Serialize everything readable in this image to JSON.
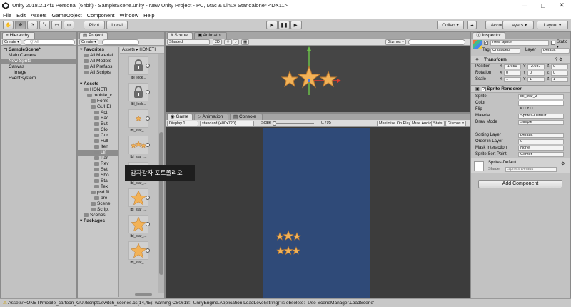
{
  "window": {
    "title": "Unity 2018.2.14f1 Personal (64bit) - SampleScene.unity - New Unity Project - PC, Mac & Linux Standalone* <DX11>",
    "controls": [
      "─",
      "□",
      "✕"
    ]
  },
  "menu": [
    "File",
    "Edit",
    "Assets",
    "GameObject",
    "Component",
    "Window",
    "Help"
  ],
  "toolbar": {
    "pivot": "Pivot",
    "local": "Local",
    "collab": "Collab ▾",
    "account": "Account ▾",
    "layers": "Layers ▾",
    "layout": "Layout ▾"
  },
  "hierarchy": {
    "tab": "Hierarchy",
    "create": "Create ▾",
    "search_placeholder": "Q*All",
    "rows": [
      {
        "label": "SampleScene*",
        "indent": 0,
        "kind": "scene",
        "selected": false
      },
      {
        "label": "Main Camera",
        "indent": 1,
        "kind": "obj",
        "selected": false
      },
      {
        "label": "New Sprite",
        "indent": 1,
        "kind": "obj",
        "selected": true
      },
      {
        "label": "Canvas",
        "indent": 1,
        "kind": "obj",
        "selected": false
      },
      {
        "label": "Image",
        "indent": 2,
        "kind": "obj",
        "selected": false
      },
      {
        "label": "EventSystem",
        "indent": 1,
        "kind": "obj",
        "selected": false
      }
    ]
  },
  "project": {
    "tab": "Project",
    "create": "Create ▾",
    "breadcrumb": "Assets ▸ HONETI",
    "tree": [
      {
        "label": "Favorites",
        "indent": 0,
        "bold": true,
        "selected": false
      },
      {
        "label": "All Material",
        "indent": 1,
        "bold": false,
        "selected": false
      },
      {
        "label": "All Models",
        "indent": 1,
        "bold": false,
        "selected": false
      },
      {
        "label": "All Prefabs",
        "indent": 1,
        "bold": false,
        "selected": false
      },
      {
        "label": "All Scripts",
        "indent": 1,
        "bold": false,
        "selected": false
      },
      {
        "label": "",
        "indent": 0,
        "bold": false,
        "selected": false
      },
      {
        "label": "Assets",
        "indent": 0,
        "bold": true,
        "selected": false
      },
      {
        "label": "HONETI",
        "indent": 1,
        "bold": false,
        "selected": false
      },
      {
        "label": "mobile_c",
        "indent": 2,
        "bold": false,
        "selected": false
      },
      {
        "label": "Fonts",
        "indent": 3,
        "bold": false,
        "selected": false
      },
      {
        "label": "GUI El",
        "indent": 3,
        "bold": false,
        "selected": false
      },
      {
        "label": "Act",
        "indent": 4,
        "bold": false,
        "selected": false
      },
      {
        "label": "Bac",
        "indent": 4,
        "bold": false,
        "selected": false
      },
      {
        "label": "But",
        "indent": 4,
        "bold": false,
        "selected": false
      },
      {
        "label": "Clo",
        "indent": 4,
        "bold": false,
        "selected": false
      },
      {
        "label": "Cur",
        "indent": 4,
        "bold": false,
        "selected": false
      },
      {
        "label": "Full",
        "indent": 4,
        "bold": false,
        "selected": false
      },
      {
        "label": "Iten",
        "indent": 4,
        "bold": false,
        "selected": false
      },
      {
        "label": "Lif",
        "indent": 4,
        "bold": false,
        "selected": true
      },
      {
        "label": "Par",
        "indent": 4,
        "bold": false,
        "selected": false
      },
      {
        "label": "Rev",
        "indent": 4,
        "bold": false,
        "selected": false
      },
      {
        "label": "Set",
        "indent": 4,
        "bold": false,
        "selected": false
      },
      {
        "label": "Sho",
        "indent": 4,
        "bold": false,
        "selected": false
      },
      {
        "label": "Sta",
        "indent": 4,
        "bold": false,
        "selected": false
      },
      {
        "label": "Tex",
        "indent": 4,
        "bold": false,
        "selected": false
      },
      {
        "label": "psd fil",
        "indent": 3,
        "bold": false,
        "selected": false
      },
      {
        "label": "pre",
        "indent": 4,
        "bold": false,
        "selected": false
      },
      {
        "label": "Scene",
        "indent": 3,
        "bold": false,
        "selected": false
      },
      {
        "label": "Script",
        "indent": 3,
        "bold": false,
        "selected": false
      },
      {
        "label": "Scenes",
        "indent": 1,
        "bold": false,
        "selected": false
      },
      {
        "label": "Packages",
        "indent": 0,
        "bold": true,
        "selected": false
      }
    ],
    "items": [
      {
        "label": "lbl_lock...",
        "kind": "lock"
      },
      {
        "label": "lbl_lock...",
        "kind": "lock"
      },
      {
        "label": "lbl_star_...",
        "kind": "star1"
      },
      {
        "label": "lbl_star_...",
        "kind": "star3"
      },
      {
        "label": "lbl_star_...",
        "kind": "star3"
      },
      {
        "label": "lbl_star_...",
        "kind": "bigstar"
      },
      {
        "label": "lbl_star_...",
        "kind": "bigstar"
      },
      {
        "label": "lbl_star_...",
        "kind": "bigstar"
      }
    ]
  },
  "scene": {
    "tab": "Scene",
    "animator_tab": "Animator",
    "shading": "Shaded",
    "mode": "2D",
    "gizmos": "Gizmos ▾"
  },
  "game": {
    "tab": "Game",
    "animation_tab": "Animation",
    "console_tab": "Console",
    "display": "Display 1",
    "resolution": "standard (400x720)",
    "scale_label": "Scale",
    "scale_value": "0.795",
    "maximize": "Maximize On Play",
    "mute": "Mute Audio",
    "stats": "Stats",
    "gizmos": "Gizmos ▾"
  },
  "inspector": {
    "tab": "Inspector",
    "name": "New Sprite",
    "static": "Static ▾",
    "tag_label": "Tag",
    "tag": "Untagged",
    "layer_label": "Layer",
    "layer": "Default",
    "transform_title": "Transform",
    "position_label": "Position",
    "position": {
      "x": "-1.659",
      "y": "-2.037",
      "z": "0"
    },
    "rotation_label": "Rotation",
    "rotation": {
      "x": "0",
      "y": "0",
      "z": "0"
    },
    "scale_label": "Scale",
    "scale": {
      "x": "1",
      "y": "1",
      "z": "1"
    },
    "renderer_title": "Sprite Renderer",
    "props": [
      {
        "label": "Sprite",
        "value": "lbl_star_3"
      },
      {
        "label": "Color",
        "value": ""
      },
      {
        "label": "Flip",
        "value": "X □  Y □"
      },
      {
        "label": "Material",
        "value": "Sprites-Default"
      },
      {
        "label": "Draw Mode",
        "value": "Simple"
      },
      {
        "label": "",
        "value": ""
      },
      {
        "label": "Sorting Layer",
        "value": "Default"
      },
      {
        "label": "Order in Layer",
        "value": "0"
      },
      {
        "label": "Mask Interaction",
        "value": "None"
      },
      {
        "label": "Sprite Sort Point",
        "value": "Center"
      }
    ],
    "material_name": "Sprites-Default",
    "shader_label": "Shader",
    "shader": "Sprites/Default",
    "add_component": "Add Component"
  },
  "tooltip": "감자감자 포트폴리오",
  "status": "Assets/HONETI/mobile_cartoon_GUI/Scripts/switch_scenes.cs(14,45): warning CS0618: `UnityEngine.Application.LoadLevel(string)' is obsolete: `Use SceneManager.LoadScene'",
  "colors": {
    "game_bg": "#2f4a78",
    "game_letterbox": "#3c3c3c",
    "scene_bg": "#454545",
    "star": "#f2b257"
  }
}
